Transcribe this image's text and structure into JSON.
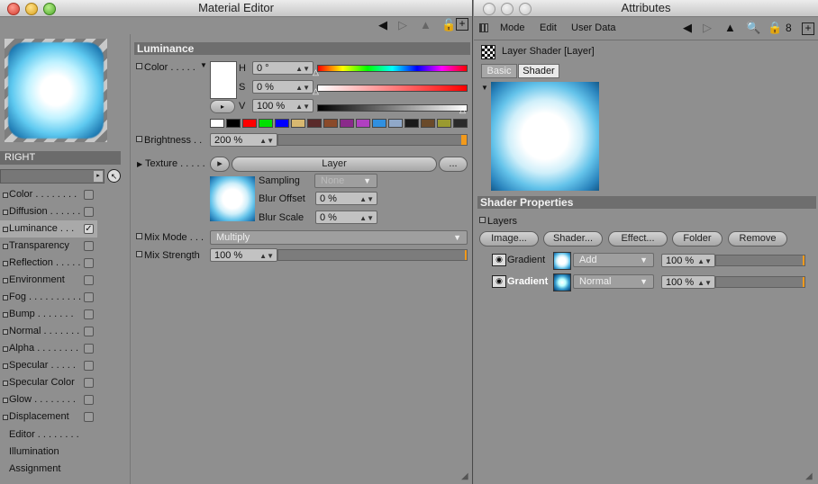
{
  "material_editor": {
    "title": "Material Editor",
    "material_name": "RIGHT",
    "channels": [
      {
        "label": "Color . . . . . . . .",
        "checked": false
      },
      {
        "label": "Diffusion . . . . . .",
        "checked": false
      },
      {
        "label": "Luminance . . .",
        "checked": true,
        "selected": true
      },
      {
        "label": "Transparency",
        "checked": false
      },
      {
        "label": "Reflection . . . . .",
        "checked": false
      },
      {
        "label": "Environment",
        "checked": false
      },
      {
        "label": "Fog . . . . . . . . . .",
        "checked": false
      },
      {
        "label": "Bump . . . . . . .",
        "checked": false
      },
      {
        "label": "Normal . . . . . . .",
        "checked": false
      },
      {
        "label": "Alpha . . . . . . . .",
        "checked": false
      },
      {
        "label": "Specular . . . . .",
        "checked": false
      },
      {
        "label": "Specular Color",
        "checked": false
      },
      {
        "label": "Glow . . . . . . . .",
        "checked": false
      },
      {
        "label": "Displacement",
        "checked": false
      }
    ],
    "extra_items": [
      "Editor . . . . . . . .",
      "Illumination",
      "Assignment"
    ],
    "section_title": "Luminance",
    "color_label": "Color . . . . .",
    "h_label": "H",
    "h_value": "0 °",
    "s_label": "S",
    "s_value": "0 %",
    "v_label": "V",
    "v_value": "100 %",
    "swatches": [
      "#ffffff",
      "#000000",
      "#ff0000",
      "#00e000",
      "#0000ff",
      "#d8b870",
      "#5a2a2a",
      "#8a4a2a",
      "#8a2a8a",
      "#b040c0",
      "#3090e0",
      "#90a8c8",
      "#1a1a1a",
      "#6a4a2a",
      "#9a9a30",
      "#2a2a2a"
    ],
    "brightness_label": "Brightness . .",
    "brightness_value": "200 %",
    "brightness_level": 1.0,
    "texture_label": "Texture . . . . .",
    "texture_button": "Layer",
    "texture_more": "...",
    "sampling_label": "Sampling",
    "sampling_value": "None",
    "blur_offset_label": "Blur Offset",
    "blur_offset_value": "0 %",
    "blur_scale_label": "Blur Scale",
    "blur_scale_value": "0 %",
    "mix_mode_label": "Mix Mode . . .",
    "mix_mode_value": "Multiply",
    "mix_strength_label": "Mix Strength",
    "mix_strength_value": "100 %"
  },
  "attributes": {
    "title": "Attributes",
    "menu": [
      "Mode",
      "Edit",
      "User Data"
    ],
    "object_title": "Layer Shader [Layer]",
    "tabs": [
      {
        "label": "Basic",
        "active": false
      },
      {
        "label": "Shader",
        "active": true
      }
    ],
    "section_title": "Shader Properties",
    "layers_label": "Layers",
    "buttons": [
      "Image...",
      "Shader...",
      "Effect...",
      "Folder",
      "Remove"
    ],
    "layers": [
      {
        "name": "Gradient",
        "mode": "Add",
        "opacity": "100 %"
      },
      {
        "name": "Gradient",
        "mode": "Normal",
        "opacity": "100 %"
      }
    ]
  }
}
